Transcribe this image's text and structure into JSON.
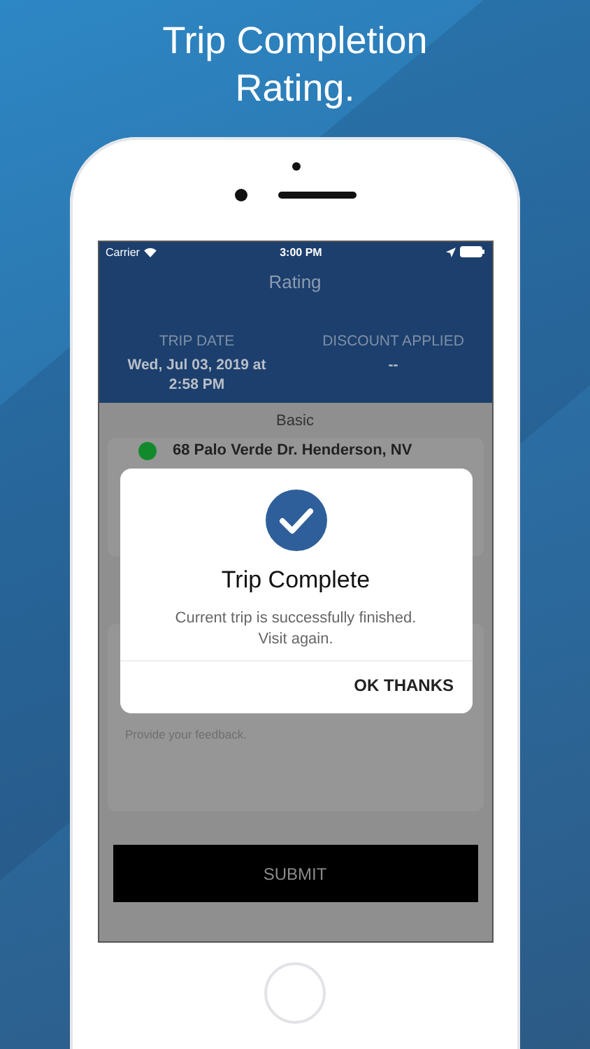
{
  "headline": "Trip Completion Rating.",
  "status_bar": {
    "carrier": "Carrier",
    "time": "3:00 PM"
  },
  "screen_title": "Rating",
  "summary": [
    {
      "label": "TRIP DATE",
      "value": "Wed, Jul 03, 2019 at 2:58 PM"
    },
    {
      "label": "DISCOUNT APPLIED",
      "value": "--"
    }
  ],
  "section": "Basic",
  "stops": [
    {
      "address": "68 Palo Verde Dr. Henderson, NV",
      "color": "#128a2c"
    }
  ],
  "feedback": {
    "placeholder": "Provide your feedback."
  },
  "submit": "SUBMIT",
  "dialog": {
    "title": "Trip Complete",
    "message": "Current trip is successfully finished. Visit again.",
    "action": "OK THANKS"
  }
}
